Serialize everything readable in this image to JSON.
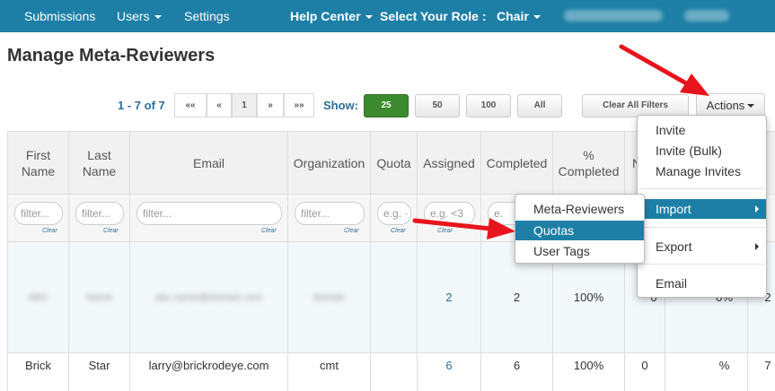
{
  "nav": {
    "submissions": "Submissions",
    "users": "Users",
    "settings": "Settings",
    "help_center": "Help Center",
    "role_label": "Select Your Role :",
    "role_value": "Chair"
  },
  "page": {
    "title": "Manage Meta-Reviewers"
  },
  "pager": {
    "range": "1 - 7 of 7",
    "first": "««",
    "prev": "«",
    "current": "1",
    "next": "»",
    "last": "»»"
  },
  "show": {
    "label": "Show:",
    "options": [
      "25",
      "50",
      "100",
      "All"
    ],
    "selected": "25"
  },
  "toolbar": {
    "clear_filters": "Clear All Filters",
    "actions": "Actions"
  },
  "table": {
    "columns": [
      "First Name",
      "Last Name",
      "Email",
      "Organization",
      "Quota",
      "Assigned",
      "Completed",
      "% Completed",
      "N",
      "",
      ""
    ],
    "filter_placeholders": [
      "filter...",
      "filter...",
      "filter...",
      "filter...",
      "e.g. ·",
      "e.g. <3",
      "e."
    ],
    "clear_label": "Clear",
    "rows": [
      {
        "first": "",
        "last": "",
        "email": "",
        "org": "",
        "quota": "",
        "assigned": "2",
        "completed": "2",
        "pct": "100%",
        "c9": "0",
        "c10": "0%",
        "c11": "2"
      },
      {
        "first": "Brick",
        "last": "Star",
        "email": "larry@brickrodeye.com",
        "org": "cmt",
        "quota": "",
        "assigned": "6",
        "completed": "6",
        "pct": "100%",
        "c9": "0",
        "c10": "%",
        "c11": "7"
      }
    ]
  },
  "actions_menu": {
    "items": [
      "Invite",
      "Invite (Bulk)",
      "Manage Invites",
      "Import",
      "Export",
      "Email"
    ]
  },
  "import_submenu": {
    "items": [
      "Meta-Reviewers",
      "Quotas",
      "User Tags"
    ],
    "highlighted": "Quotas"
  },
  "colors": {
    "brand": "#1e7fa6",
    "show_active": "#3c8a2e",
    "annotation_arrow": "#e8141c"
  }
}
